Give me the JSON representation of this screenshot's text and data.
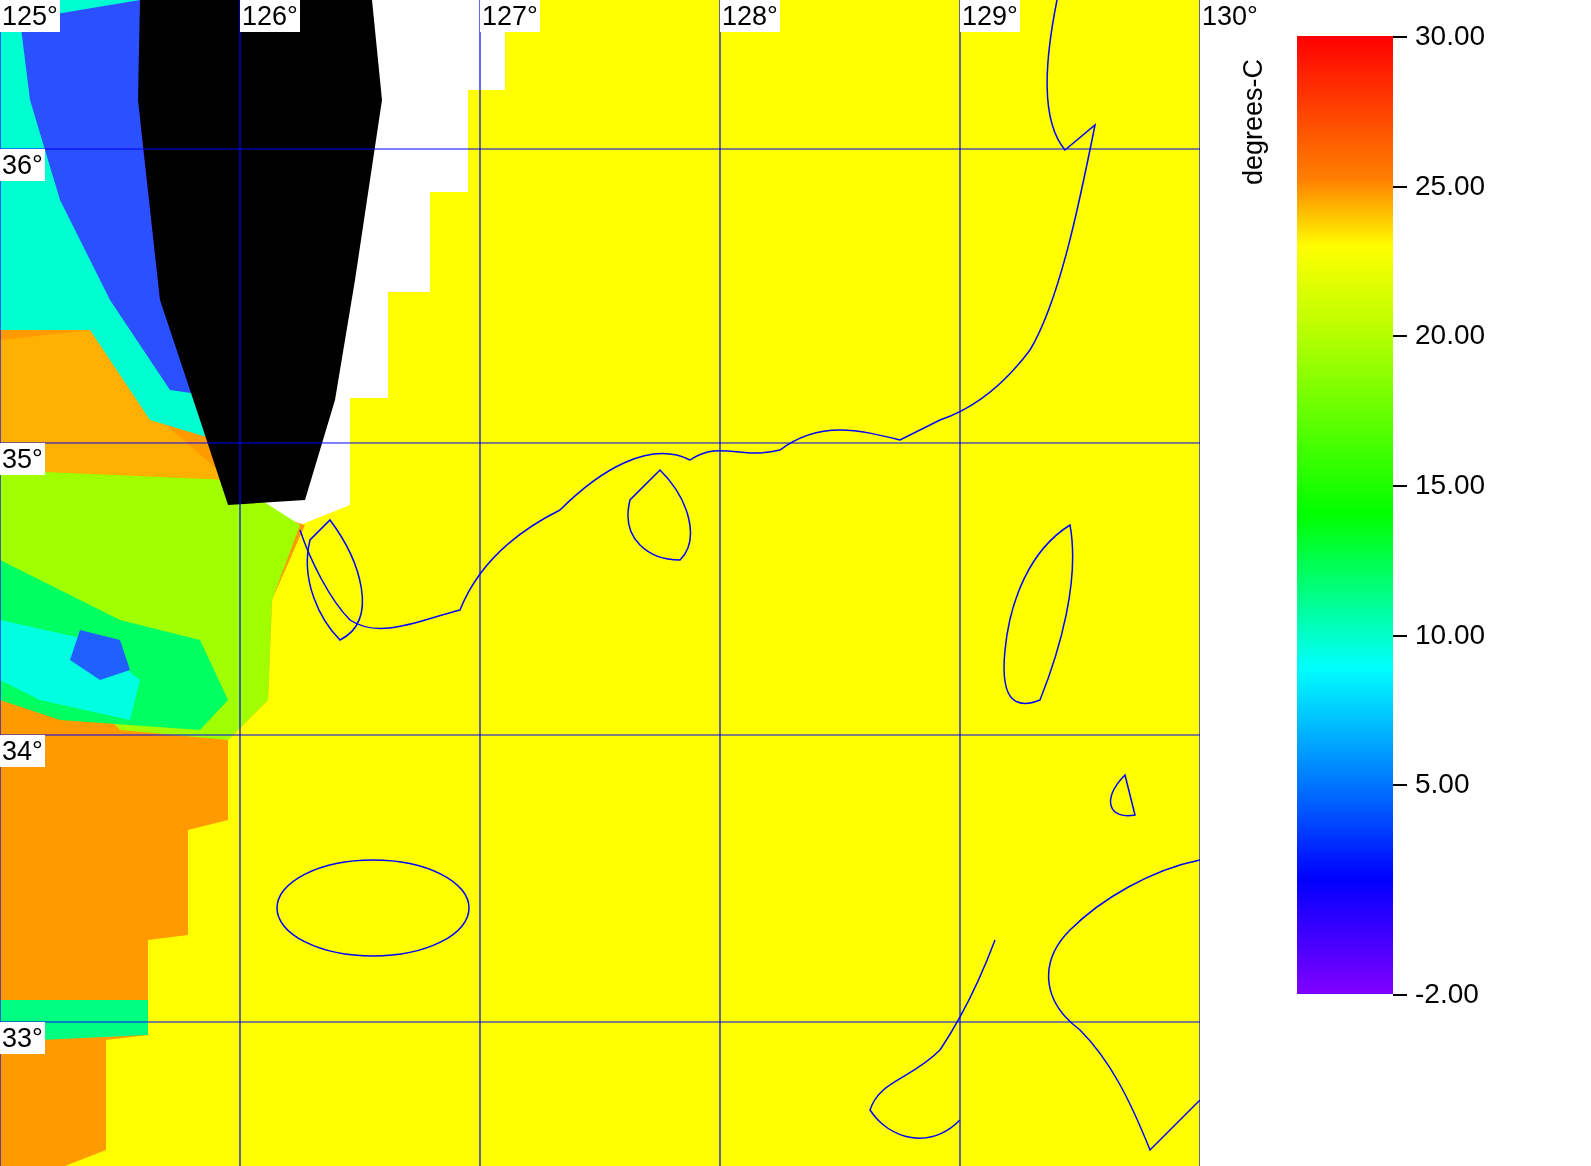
{
  "map": {
    "longitude_labels": [
      "125°",
      "126°",
      "127°",
      "128°",
      "129°",
      "130°"
    ],
    "latitude_labels": [
      "36°",
      "35°",
      "34°",
      "33°"
    ]
  },
  "colorbar": {
    "unit": "degrees-C",
    "ticks": [
      "30.00",
      "25.00",
      "20.00",
      "15.00",
      "10.00",
      "5.00",
      "-2.00"
    ]
  }
}
